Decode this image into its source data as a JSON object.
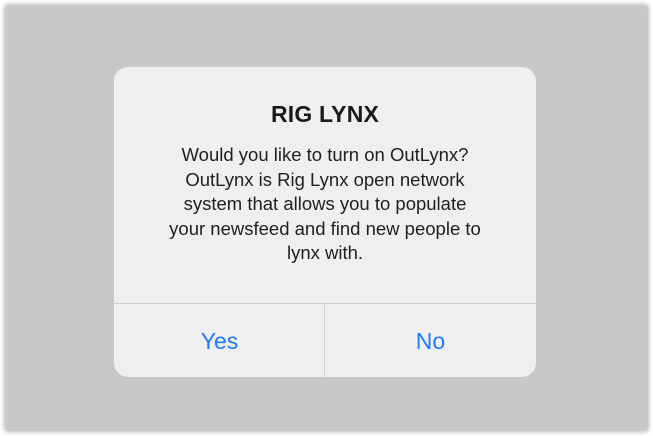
{
  "alert": {
    "title": "RIG LYNX",
    "message_lines": [
      "Would you like to turn on OutLynx?",
      "OutLynx is Rig Lynx open network",
      "system that allows you to populate",
      "your newsfeed and find new people to",
      "lynx with."
    ],
    "buttons": {
      "yes_label": "Yes",
      "no_label": "No"
    }
  },
  "colors": {
    "backdrop": "#c8c8c8",
    "alert_background": "#efefef",
    "button_text": "#1f7cf5",
    "separator": "#cfcfcf"
  }
}
